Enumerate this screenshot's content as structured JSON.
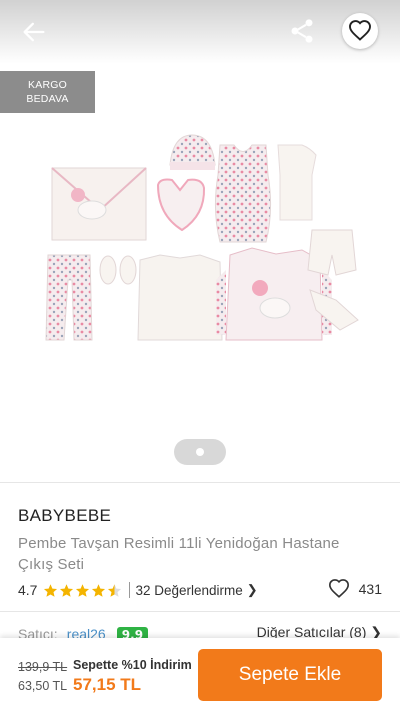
{
  "gallery": {
    "badge": {
      "line1": "KARGO",
      "line2": "BEDAVA"
    },
    "icons": {
      "back": "arrow-left-icon",
      "share": "share-icon",
      "favorite": "heart-outline-icon"
    }
  },
  "product": {
    "brand": "BABYBEBE",
    "title": "Pembe Tavşan Resimli 11li Yenidoğan Hastane Çıkış Seti",
    "rating": "4.7",
    "stars": 4.5,
    "reviews_label": "32 Değerlendirme",
    "like_count": "431"
  },
  "seller": {
    "label": "Satıcı:",
    "name": "real26",
    "score": "9.9",
    "other_sellers": "Diğer Satıcılar (8)"
  },
  "pricing": {
    "old_price": "139,9 TL",
    "current_price": "63,50 TL",
    "discount_text": "Sepette %10 İndirim",
    "basket_price": "57,15 TL"
  },
  "actions": {
    "add_to_cart": "Sepete Ekle"
  },
  "colors": {
    "accent": "#f27a1a",
    "star": "#f4b400",
    "seller_score": "#2fb344",
    "badge": "#8c8c8c"
  }
}
